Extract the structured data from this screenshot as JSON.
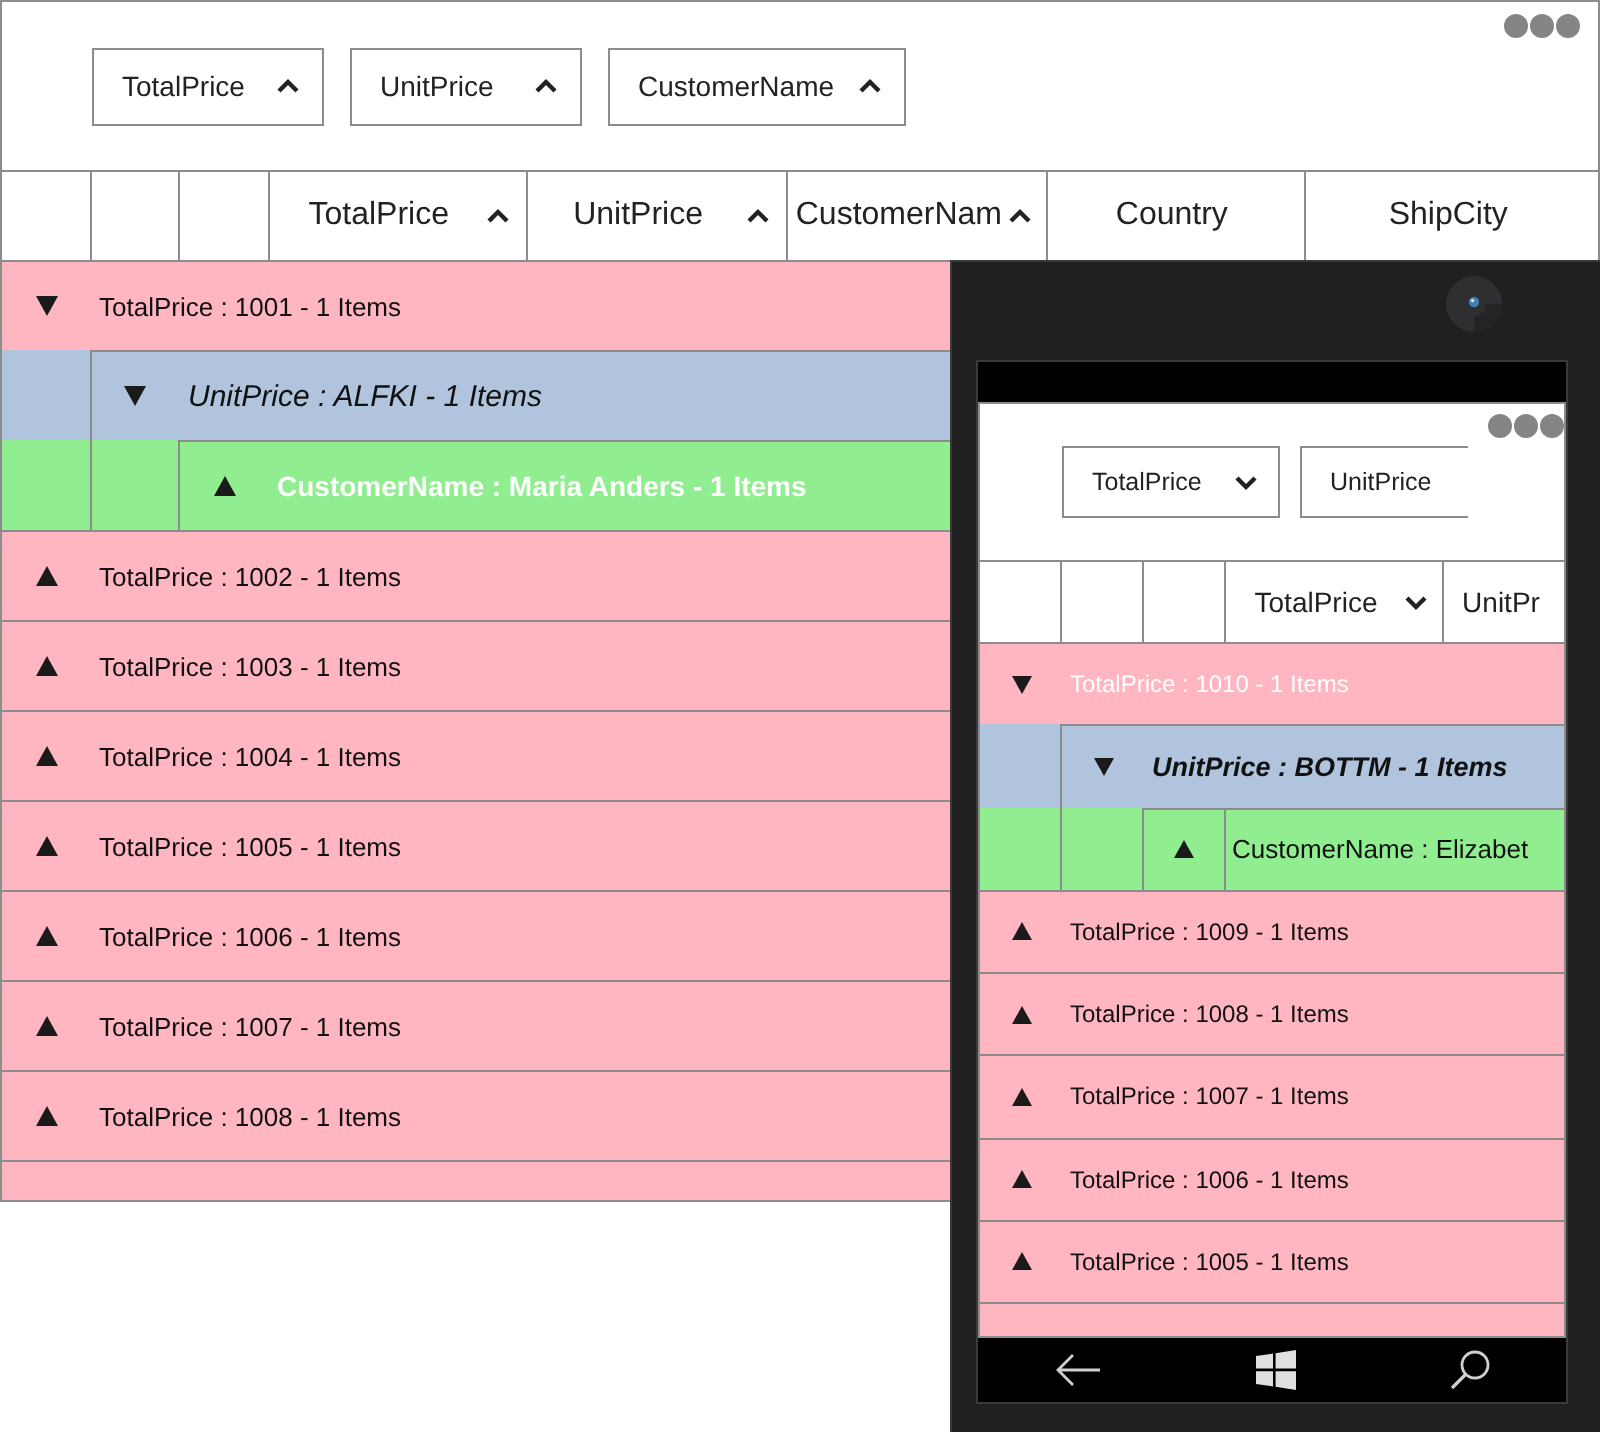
{
  "desktop": {
    "group_panel": [
      {
        "label": "TotalPrice",
        "descending": false
      },
      {
        "label": "UnitPrice",
        "descending": false
      },
      {
        "label": "CustomerName",
        "descending": false
      }
    ],
    "columns": [
      {
        "label": "TotalPrice",
        "descending": false
      },
      {
        "label": "UnitPrice",
        "descending": false
      },
      {
        "label": "CustomerNam",
        "descending": false
      },
      {
        "label": "Country"
      },
      {
        "label": "ShipCity"
      }
    ],
    "groups": [
      {
        "caption": "TotalPrice : 1001 - 1 Items",
        "expanded": true,
        "highlighted": false,
        "children": [
          {
            "caption": "UnitPrice : ALFKI - 1 Items",
            "expanded": true,
            "highlighted": false,
            "children": [
              {
                "caption": "CustomerName : Maria Anders - 1 Items",
                "expanded": false,
                "highlighted": true
              }
            ]
          }
        ]
      },
      {
        "caption": "TotalPrice : 1002 - 1 Items",
        "expanded": false,
        "highlighted": false
      },
      {
        "caption": "TotalPrice : 1003 - 1 Items",
        "expanded": false,
        "highlighted": false
      },
      {
        "caption": "TotalPrice : 1004 - 1 Items",
        "expanded": false,
        "highlighted": false
      },
      {
        "caption": "TotalPrice : 1005 - 1 Items",
        "expanded": false,
        "highlighted": false
      },
      {
        "caption": "TotalPrice : 1006 - 1 Items",
        "expanded": false,
        "highlighted": false
      },
      {
        "caption": "TotalPrice : 1007 - 1 Items",
        "expanded": false,
        "highlighted": false
      },
      {
        "caption": "TotalPrice : 1008 - 1 Items",
        "expanded": false,
        "highlighted": false
      }
    ]
  },
  "phone": {
    "group_panel": [
      {
        "label": "TotalPrice",
        "descending": true
      },
      {
        "label": "UnitPrice"
      }
    ],
    "columns": [
      {
        "label": "TotalPrice",
        "descending": true
      },
      {
        "label": "UnitPr"
      }
    ],
    "groups": [
      {
        "caption": "TotalPrice : 1010 - 1 Items",
        "expanded": true,
        "highlighted": true,
        "children": [
          {
            "caption": "UnitPrice : BOTTM - 1 Items",
            "expanded": true,
            "highlighted": false,
            "children": [
              {
                "caption": "CustomerName : Elizabet",
                "expanded": false,
                "highlighted": false
              }
            ]
          }
        ]
      },
      {
        "caption": "TotalPrice : 1009 - 1 Items",
        "expanded": false,
        "highlighted": false
      },
      {
        "caption": "TotalPrice : 1008 - 1 Items",
        "expanded": false,
        "highlighted": false
      },
      {
        "caption": "TotalPrice : 1007 - 1 Items",
        "expanded": false,
        "highlighted": false
      },
      {
        "caption": "TotalPrice : 1006 - 1 Items",
        "expanded": false,
        "highlighted": false
      },
      {
        "caption": "TotalPrice : 1005 - 1 Items",
        "expanded": false,
        "highlighted": false
      }
    ]
  }
}
